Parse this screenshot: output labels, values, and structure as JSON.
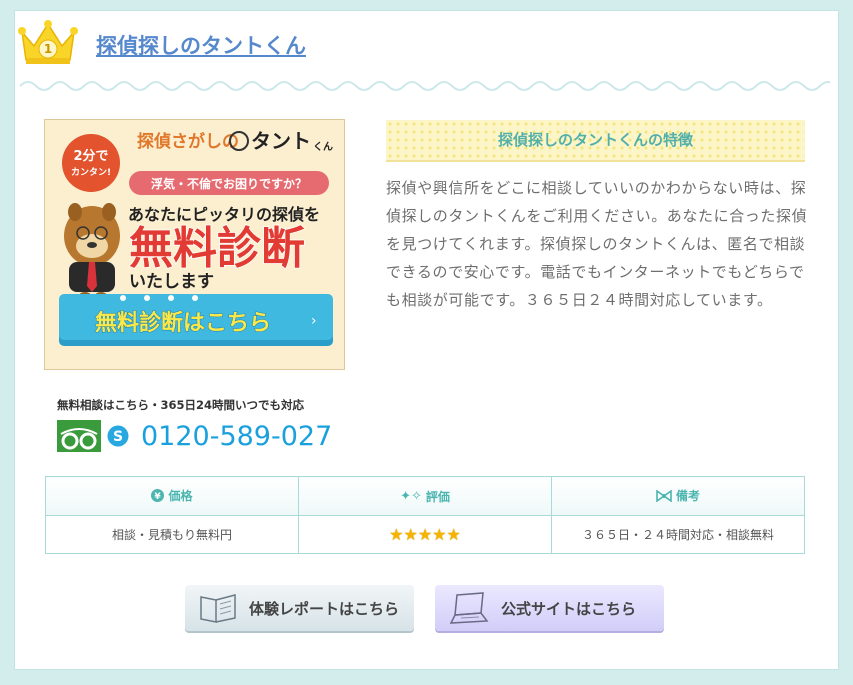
{
  "header": {
    "rank_number": "1",
    "title": "探偵探しのタントくん"
  },
  "banner": {
    "logo_text": "探偵さがしの",
    "logo_brand": "タント",
    "logo_kun": "くん",
    "badge_line1": "2分で",
    "badge_line2": "カンタン!",
    "pill_text": "浮気・不倫でお困りですか？",
    "line1": "あなたにピッタリの探偵を",
    "big_text": "無料診断",
    "line3": "いたします",
    "cta_label": "無料診断はこちら"
  },
  "feature": {
    "heading": "探偵探しのタントくんの特徴",
    "body": "探偵や興信所をどこに相談していいのかわからない時は、探偵探しのタントくんをご利用ください。あなたに合った探偵を見つけてくれます。探偵探しのタントくんは、匿名で相談できるので安心です。電話でもインターネットでもどちらでも相談が可能です。３６５日２４時間対応しています。"
  },
  "contact": {
    "note": "無料相談はこちら・365日24時間いつでも対応",
    "phone": "0120-589-027"
  },
  "table": {
    "headers": [
      "価格",
      "評価",
      "備考"
    ],
    "price": "相談・見積もり無料円",
    "rating": 5,
    "notes": "３６５日・２４時間対応・相談無料"
  },
  "buttons": {
    "report": "体験レポートはこちら",
    "official": "公式サイトはこちら"
  },
  "colors": {
    "accent": "#4bb5b0",
    "link": "#5588cc",
    "phone": "#1aa0dd",
    "star": "#f5b400"
  }
}
